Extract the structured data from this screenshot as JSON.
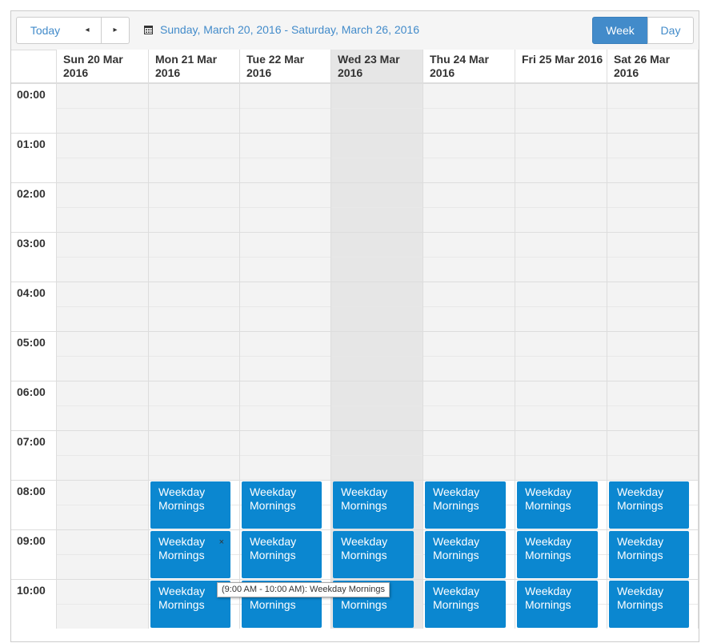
{
  "toolbar": {
    "today_label": "Today",
    "prev_icon": "◂",
    "next_icon": "▸",
    "range_label": "Sunday, March 20, 2016 - Saturday, March 26, 2016",
    "week_label": "Week",
    "day_label": "Day",
    "active_view": "Week",
    "accent_color": "#428bca"
  },
  "days": [
    {
      "label": "Sun 20 Mar 2016",
      "today": false
    },
    {
      "label": "Mon 21 Mar 2016",
      "today": false
    },
    {
      "label": "Tue 22 Mar 2016",
      "today": false
    },
    {
      "label": "Wed 23 Mar 2016",
      "today": true
    },
    {
      "label": "Thu 24 Mar 2016",
      "today": false
    },
    {
      "label": "Fri 25 Mar 2016",
      "today": false
    },
    {
      "label": "Sat 26 Mar 2016",
      "today": false
    }
  ],
  "hours": [
    "00:00",
    "01:00",
    "02:00",
    "03:00",
    "04:00",
    "05:00",
    "06:00",
    "07:00",
    "08:00",
    "09:00",
    "10:00"
  ],
  "events": [
    {
      "title": "Weekday Mornings",
      "day": 1,
      "hour": 8
    },
    {
      "title": "Weekday Mornings",
      "day": 2,
      "hour": 8
    },
    {
      "title": "Weekday Mornings",
      "day": 3,
      "hour": 8
    },
    {
      "title": "Weekday Mornings",
      "day": 4,
      "hour": 8
    },
    {
      "title": "Weekday Mornings",
      "day": 5,
      "hour": 8
    },
    {
      "title": "Weekday Mornings",
      "day": 6,
      "hour": 8
    },
    {
      "title": "Weekday Mornings",
      "day": 1,
      "hour": 9,
      "hovered": true
    },
    {
      "title": "Weekday Mornings",
      "day": 2,
      "hour": 9
    },
    {
      "title": "Weekday Mornings",
      "day": 3,
      "hour": 9
    },
    {
      "title": "Weekday Mornings",
      "day": 4,
      "hour": 9
    },
    {
      "title": "Weekday Mornings",
      "day": 5,
      "hour": 9
    },
    {
      "title": "Weekday Mornings",
      "day": 6,
      "hour": 9
    },
    {
      "title": "Weekday Mornings",
      "day": 1,
      "hour": 10
    },
    {
      "title": "Weekday Mornings",
      "day": 2,
      "hour": 10
    },
    {
      "title": "Weekday Mornings",
      "day": 3,
      "hour": 10
    },
    {
      "title": "Weekday Mornings",
      "day": 4,
      "hour": 10
    },
    {
      "title": "Weekday Mornings",
      "day": 5,
      "hour": 10
    },
    {
      "title": "Weekday Mornings",
      "day": 6,
      "hour": 10
    }
  ],
  "event_close_icon": "×",
  "event_color": "#0b87d0",
  "tooltip": "(9:00 AM - 10:00 AM): Weekday Mornings"
}
